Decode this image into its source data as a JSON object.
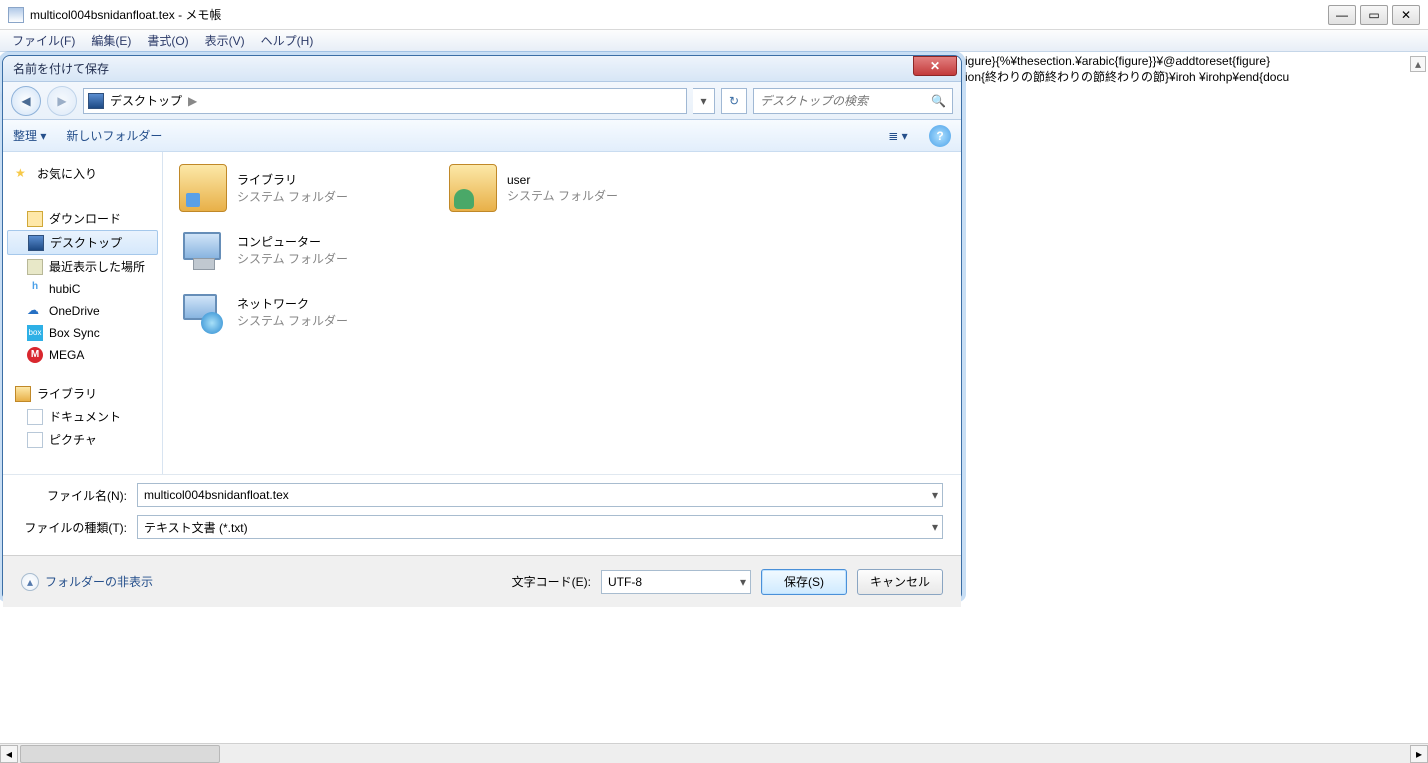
{
  "notepad": {
    "title": "multicol004bsnidanfloat.tex - メモ帳",
    "menu": {
      "file": "ファイル(F)",
      "edit": "編集(E)",
      "format": "書式(O)",
      "view": "表示(V)",
      "help": "ヘルプ(H)"
    },
    "visible_line1": "igure}{%¥thesection.¥arabic{figure}}¥@addtoreset{figure}",
    "visible_line2": "ion{終わりの節終わりの節終わりの節}¥iroh ¥irohp¥end{docu"
  },
  "dialog": {
    "title": "名前を付けて保存",
    "breadcrumb": {
      "location": "デスクトップ",
      "sep": "▶"
    },
    "search_placeholder": "デスクトップの検索",
    "toolbar": {
      "organize": "整理 ▾",
      "newfolder": "新しいフォルダー"
    },
    "tree": {
      "favorites": "お気に入り",
      "downloads": "ダウンロード",
      "desktop": "デスクトップ",
      "recent": "最近表示した場所",
      "hubic": "hubiC",
      "onedrive": "OneDrive",
      "boxsync": "Box Sync",
      "mega": "MEGA",
      "libraries": "ライブラリ",
      "documents": "ドキュメント",
      "pictures": "ピクチャ"
    },
    "items": {
      "libraries": {
        "name": "ライブラリ",
        "sub": "システム フォルダー"
      },
      "user": {
        "name": "user",
        "sub": "システム フォルダー"
      },
      "computer": {
        "name": "コンピューター",
        "sub": "システム フォルダー"
      },
      "network": {
        "name": "ネットワーク",
        "sub": "システム フォルダー"
      }
    },
    "fields": {
      "filename_label": "ファイル名(N):",
      "filename_value": "multicol004bsnidanfloat.tex",
      "filetype_label": "ファイルの種類(T):",
      "filetype_value": "テキスト文書 (*.txt)"
    },
    "footer": {
      "hide_folders": "フォルダーの非表示",
      "encoding_label": "文字コード(E):",
      "encoding_value": "UTF-8",
      "save": "保存(S)",
      "cancel": "キャンセル"
    }
  }
}
